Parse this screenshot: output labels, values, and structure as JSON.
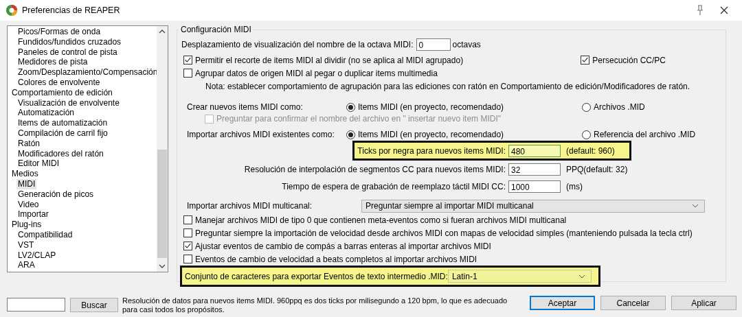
{
  "window": {
    "title": "Preferencias de REAPER"
  },
  "tree": [
    {
      "children": [
        {
          "label": "Picos/Formas de onda",
          "selected": false
        },
        {
          "label": "Fundidos/fundidos cruzados",
          "selected": false
        },
        {
          "label": "Paneles de control de pista",
          "selected": false
        },
        {
          "label": "Medidores de pista",
          "selected": false
        },
        {
          "label": "Zoom/Desplazamiento/Compensación",
          "selected": false
        },
        {
          "label": "Colores de envolvente",
          "selected": false
        }
      ]
    },
    {
      "label": "Comportamiento de edición",
      "selected": false,
      "children": [
        {
          "label": "Visualización de envolvente",
          "selected": false
        },
        {
          "label": "Automatización",
          "selected": false
        },
        {
          "label": "Items de automatización",
          "selected": false
        },
        {
          "label": "Compilación de carril fijo",
          "selected": false
        },
        {
          "label": "Ratón",
          "selected": false
        },
        {
          "label": "Modificadores del ratón",
          "selected": false
        },
        {
          "label": "Editor MIDI",
          "selected": false
        }
      ]
    },
    {
      "label": "Medios",
      "selected": false,
      "children": [
        {
          "label": "MIDI",
          "selected": true
        },
        {
          "label": "Generación de picos",
          "selected": false
        },
        {
          "label": "Video",
          "selected": false
        },
        {
          "label": "Importar",
          "selected": false
        }
      ]
    },
    {
      "label": "Plug-ins",
      "selected": false,
      "children": [
        {
          "label": "Compatibilidad",
          "selected": false
        },
        {
          "label": "VST",
          "selected": false
        },
        {
          "label": "LV2/CLAP",
          "selected": false
        },
        {
          "label": "ARA",
          "selected": false
        }
      ]
    }
  ],
  "search": {
    "button": "Buscar"
  },
  "help_text": "Resolución de datos para nuevos items MIDI. 960ppq es dos ticks por milisegundo a 120 bpm, lo que es adecuado para casi todos los propósitos.",
  "buttons": [
    {
      "label": "Aceptar",
      "default": true
    },
    {
      "label": "Cancelar",
      "default": false
    },
    {
      "label": "Aplicar",
      "default": false
    }
  ],
  "section": {
    "title": "Configuración MIDI",
    "octave_offset": {
      "label": "Desplazamiento de visualización del nombre de la octava MIDI:",
      "value": "0",
      "unit": "octavas"
    },
    "top_options": [
      {
        "label": "Permitir el recorte de items MIDI al dividir (no se aplica al MIDI agrupado)",
        "checked": true
      },
      {
        "label": "Agrupar datos de origen MIDI al pegar o duplicar items multimedia",
        "checked": false
      }
    ],
    "chase": {
      "label": "Persecución CC/PC",
      "checked": true
    },
    "note": "Nota: establecer comportamiento de agrupación para las ediciones con ratón en Comportamiento de edición/Modificadores de ratón.",
    "radio_groups": [
      {
        "label": "Crear nuevos items MIDI como:",
        "options": [
          {
            "label": "Items MIDI (en proyecto, recomendado)",
            "selected": true
          },
          {
            "label": "Archivos .MID",
            "selected": false
          }
        ],
        "sub_option": {
          "label": "Preguntar para confirmar el nombre del archivo en \" insertar nuevo item MIDI\"",
          "checked": false,
          "disabled": true
        }
      },
      {
        "label": "Importar archivos MIDI existentes como:",
        "options": [
          {
            "label": "Items MIDI (en proyecto, recomendado)",
            "selected": true
          },
          {
            "label": "Referencia del archivo .MID",
            "selected": false
          }
        ]
      }
    ],
    "numeric_fields": [
      {
        "label": "Ticks por negra para nuevos items MIDI:",
        "value": "480",
        "suffix": "(default: 960)",
        "highlighted": true
      },
      {
        "label": "Resolución de interpolación de segmentos CC para nuevos items MIDI:",
        "value": "32",
        "suffix": "PPQ(default: 32)",
        "highlighted": false
      },
      {
        "label": "Tiempo de espera de grabación de reemplazo táctil MIDI CC:",
        "value": "1000",
        "suffix": "(ms)",
        "highlighted": false
      }
    ],
    "multichannel": {
      "label": "Importar archivos MIDI multicanal:",
      "value": "Preguntar siempre al importar MIDI multicanal"
    },
    "options": [
      {
        "label": "Manejar archivos MIDI de tipo 0 que contienen meta-eventos como si fueran archivos MIDI multicanal",
        "checked": false
      },
      {
        "label": "Preguntar siempre la importación de velocidad desde archivos MIDI con mapas de velocidad simples (manteniendo pulsada la tecla ctrl)",
        "checked": false
      },
      {
        "label": "Ajustar eventos de cambio de compás a barras enteras al importar archivos MIDI",
        "checked": true
      },
      {
        "label": "Eventos de cambio de velocidad a beats completos al importar archivos MIDI",
        "checked": false
      }
    ],
    "charset": {
      "label": "Conjunto de caracteres para exportar Eventos de texto intermedio .MID:",
      "value": "Latin-1",
      "highlighted": true
    }
  }
}
